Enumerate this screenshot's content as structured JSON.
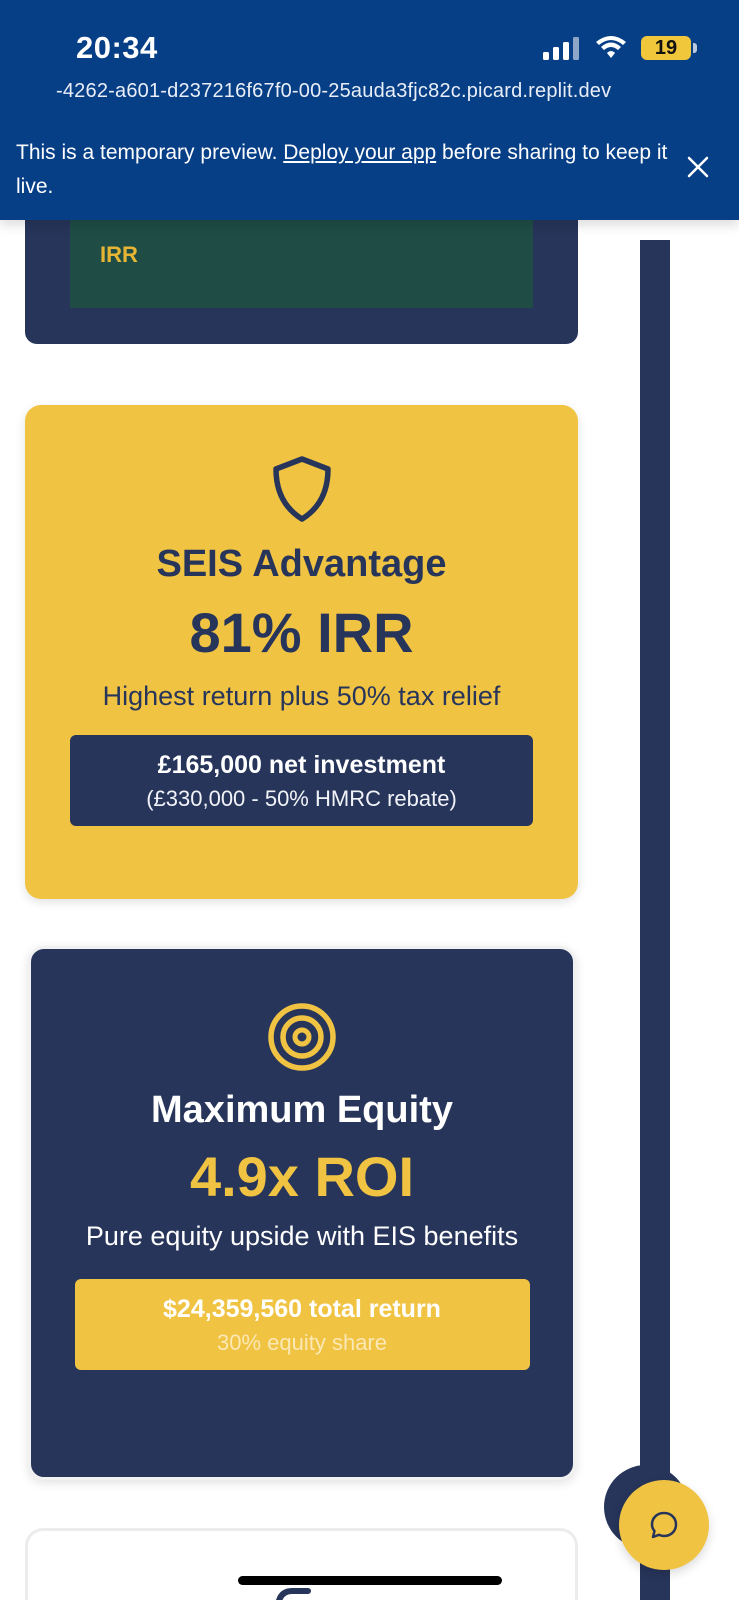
{
  "status_bar": {
    "time": "20:34",
    "battery": "19"
  },
  "browser": {
    "url": "-4262-a601-d237216f67f0-00-25auda3fjc82c.picard.replit.dev",
    "notice_prefix": "This is a temporary preview. ",
    "notice_link": "Deploy your app",
    "notice_suffix": " before sharing to keep it live."
  },
  "partial_card": {
    "label": "IRR"
  },
  "cards": [
    {
      "title": "SEIS Advantage",
      "metric": "81% IRR",
      "description": "Highest return plus 50% tax relief",
      "box_main": "£165,000 net investment",
      "box_sub": "(£330,000 - 50% HMRC rebate)",
      "icon": "shield-icon"
    },
    {
      "title": "Maximum Equity",
      "metric": "4.9x ROI",
      "description": "Pure equity upside with EIS benefits",
      "box_main": "$24,359,560 total return",
      "box_sub": "30% equity share",
      "icon": "target-icon"
    }
  ],
  "colors": {
    "navy": "#27355b",
    "yellow": "#f0c342",
    "browser_blue": "#073f87"
  }
}
